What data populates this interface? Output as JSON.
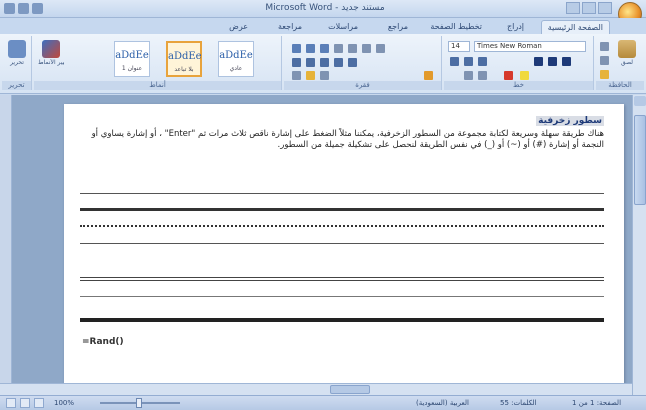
{
  "window": {
    "title": "Microsoft Word - مستند جديد",
    "icons": [
      "save-icon",
      "undo-icon",
      "redo-icon",
      "office-button-icon"
    ]
  },
  "tabs": [
    "الصفحة الرئيسية",
    "إدراج",
    "تخطيط الصفحة",
    "مراجع",
    "مراسلات",
    "مراجعة",
    "عرض"
  ],
  "ribbon": {
    "groups": [
      "الحافظة",
      "خط",
      "فقرة",
      "أنماط",
      "تحرير"
    ],
    "font_name": "Times New Roman",
    "font_size": "14",
    "styles": [
      {
        "sample": "aDdEe",
        "name": "عنوان 1"
      },
      {
        "sample": "aDdEe",
        "name": "بلا تباعد"
      },
      {
        "sample": "aDdEe",
        "name": "عادي"
      }
    ],
    "clipboard_label": "لصق",
    "change_styles_label": "تغيير الأنماط",
    "editing_label": "تحرير"
  },
  "document": {
    "heading": "سطور زخرفية",
    "paragraph": "هناك طريقة سهلة وسريعة لكتابة مجموعة من السطور الزخرفية، يمكننا مثلاً الضغط على إشارة ناقص ثلاث مرات ثم \"Enter\" ، أو إشارة يساوي أو النجمة أو إشارة (#) أو (~) أو (_) في نفس الطريقة لنحصل على تشكيلة جميلة من السطور.",
    "code_line": "=Rand()",
    "line_styles": [
      "thin",
      "thick",
      "dotted",
      "thin",
      "double",
      "thin",
      "thick"
    ]
  },
  "statusbar": {
    "page": "الصفحة: 1 من 1",
    "words": "الكلمات: 55",
    "language": "العربية (السعودية)",
    "zoom": "100%"
  }
}
